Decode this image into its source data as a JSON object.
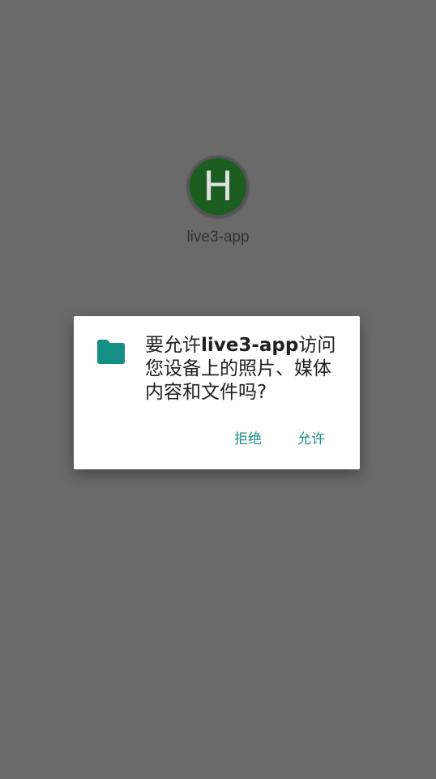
{
  "launcher": {
    "icon_letter": "H",
    "icon_color": "#1b5e20",
    "app_name": "live3-app"
  },
  "permission_dialog": {
    "icon": "folder-icon",
    "icon_color": "#138f84",
    "message_prefix": "要允许",
    "message_app": "live3-app",
    "message_suffix": "访问您设备上的照片、媒体内容和文件吗?",
    "deny_label": "拒绝",
    "allow_label": "允许",
    "accent_color": "#1e8f85"
  }
}
